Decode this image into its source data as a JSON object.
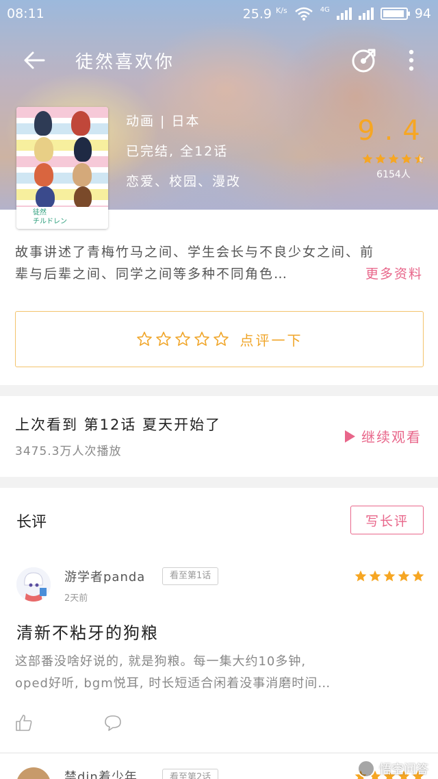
{
  "status_bar": {
    "time": "08:11",
    "speed": "25.9",
    "speed_unit": "K/s",
    "network": "4G",
    "battery": "94"
  },
  "header": {
    "title": "徒然喜欢你"
  },
  "poster": {
    "caption_line1": "徒然",
    "caption_line2": "チルドレン"
  },
  "info": {
    "category": "动画 | 日本",
    "status": "已完结, 全12话",
    "tags": "恋爱、校园、漫改"
  },
  "rating": {
    "score": "9.4",
    "stars": 4.5,
    "votes": "6154人"
  },
  "synopsis": {
    "line1": "故事讲述了青梅竹马之间、学生会长与不良少女之间、前",
    "line2": "辈与后辈之间、同学之间等多种不同角色…",
    "more_label": "更多资料"
  },
  "review_prompt": {
    "label": "点评一下"
  },
  "last_watch": {
    "title": "上次看到  第12话  夏天开始了",
    "plays": "3475.3万人次播放",
    "continue_label": "继续观看"
  },
  "long_reviews": {
    "title": "长评",
    "write_label": "写长评",
    "items": [
      {
        "user": "游学者panda",
        "badge": "看至第1话",
        "time": "2天前",
        "stars": 5,
        "headline": "清新不粘牙的狗粮",
        "body_line1": "这部番没啥好说的, 就是狗粮。每一集大约10多钟,",
        "body_line2": "oped好听, bgm悦耳, 时长短适合闲着没事消磨时间…"
      },
      {
        "user": "禁din着少年",
        "badge": "看至第2话",
        "stars": 5
      }
    ]
  },
  "watermark": {
    "label": "悟空问答"
  },
  "colors": {
    "accent_pink": "#e8668a",
    "accent_orange": "#f6a623"
  }
}
